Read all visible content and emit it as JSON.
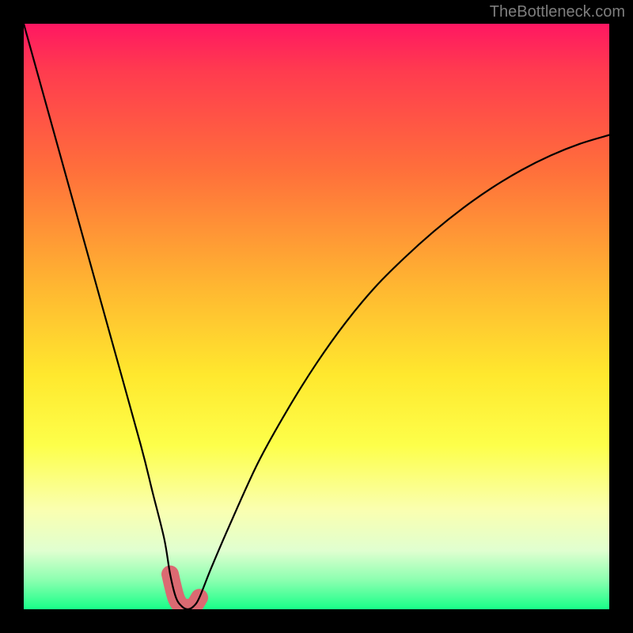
{
  "watermark": "TheBottleneck.com",
  "chart_data": {
    "type": "line",
    "title": "",
    "xlabel": "",
    "ylabel": "",
    "xlim": [
      0,
      100
    ],
    "ylim": [
      0,
      100
    ],
    "x": [
      0,
      5,
      10,
      15,
      20,
      22,
      24,
      25,
      26,
      27,
      28,
      29,
      30,
      32,
      35,
      40,
      45,
      50,
      55,
      60,
      65,
      70,
      75,
      80,
      85,
      90,
      95,
      100
    ],
    "y": [
      100,
      82,
      64,
      46,
      28,
      20,
      12,
      6,
      2,
      0.5,
      0,
      0.5,
      2,
      7,
      14,
      25,
      34,
      42,
      49,
      55,
      60,
      64.5,
      68.5,
      72,
      75,
      77.5,
      79.5,
      81
    ],
    "minimum_x": 28,
    "highlight_range_x": [
      25,
      31
    ],
    "gradient_stops": [
      {
        "pos": 0.0,
        "color": "#ff1762"
      },
      {
        "pos": 0.08,
        "color": "#ff3b4f"
      },
      {
        "pos": 0.25,
        "color": "#ff6f3b"
      },
      {
        "pos": 0.45,
        "color": "#ffb731"
      },
      {
        "pos": 0.6,
        "color": "#ffe82e"
      },
      {
        "pos": 0.72,
        "color": "#fdff4a"
      },
      {
        "pos": 0.83,
        "color": "#faffb0"
      },
      {
        "pos": 0.9,
        "color": "#e0ffd0"
      },
      {
        "pos": 0.95,
        "color": "#8cffb0"
      },
      {
        "pos": 1.0,
        "color": "#18ff88"
      }
    ],
    "highlight_color": "#db6a72"
  }
}
